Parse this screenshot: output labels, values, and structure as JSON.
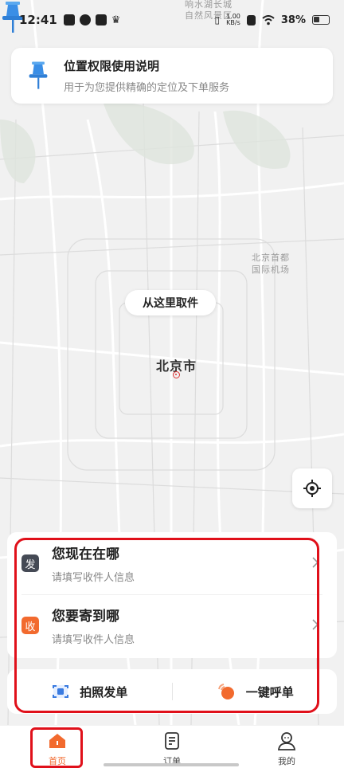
{
  "status_bar": {
    "time": "12:41",
    "network_speed": "1.00\nKB/s",
    "battery_percent": "38%"
  },
  "map": {
    "labels": [
      "北京首都\n国际机场",
      "自然风景区",
      "北京市"
    ],
    "top_labels": [
      "响水湖长城",
      "自然风景区"
    ],
    "pickup_bubble": "从这里取件"
  },
  "permission_card": {
    "title": "位置权限使用说明",
    "subtitle": "用于为您提供精确的定位及下单服务"
  },
  "address_panel": {
    "send": {
      "tag": "发",
      "title": "您现在在哪",
      "subtitle": "请填写收件人信息"
    },
    "receive": {
      "tag": "收",
      "title": "您要寄到哪",
      "subtitle": "请填写收件人信息"
    }
  },
  "actions": {
    "photo_order": "拍照发单",
    "one_click_call": "一键呼单"
  },
  "tabbar": {
    "home": "首页",
    "orders": "订单",
    "mine": "我的"
  },
  "colors": {
    "accent": "#f26a2e",
    "pin_blue": "#3a8ee6",
    "highlight_red": "#e0101a"
  }
}
